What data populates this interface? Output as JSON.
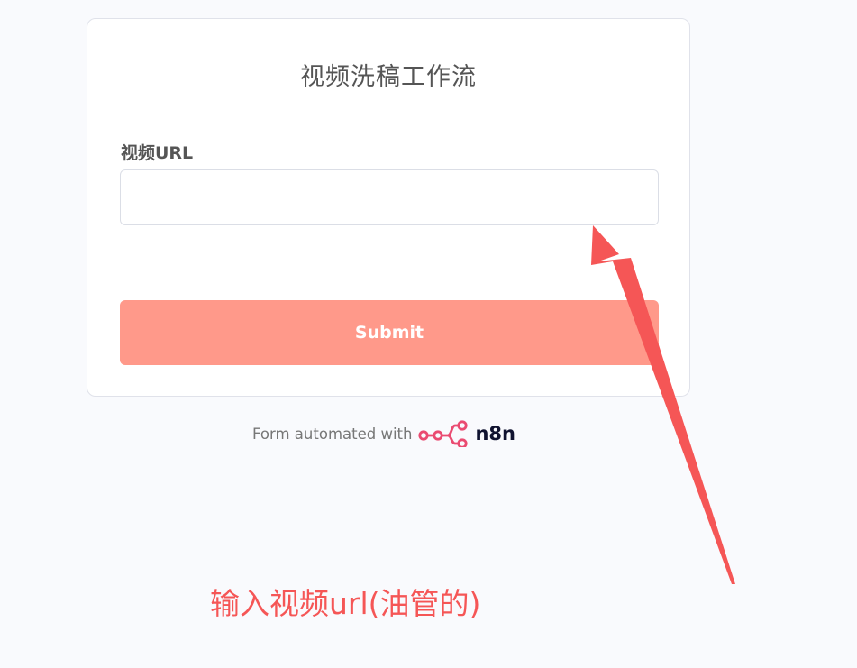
{
  "form": {
    "title": "视频洗稿工作流",
    "field_label": "视频URL",
    "url_value": "",
    "url_placeholder": "",
    "submit_label": "Submit"
  },
  "footer": {
    "text": "Form automated with",
    "brand": "n8n",
    "logo_icon": "n8n-logo-icon"
  },
  "annotation": {
    "text": "输入视频url(油管的)",
    "color": "#f55656"
  },
  "colors": {
    "submit_bg": "#ff998a",
    "logo_pink": "#ea4b71",
    "arrow": "#f55656"
  }
}
